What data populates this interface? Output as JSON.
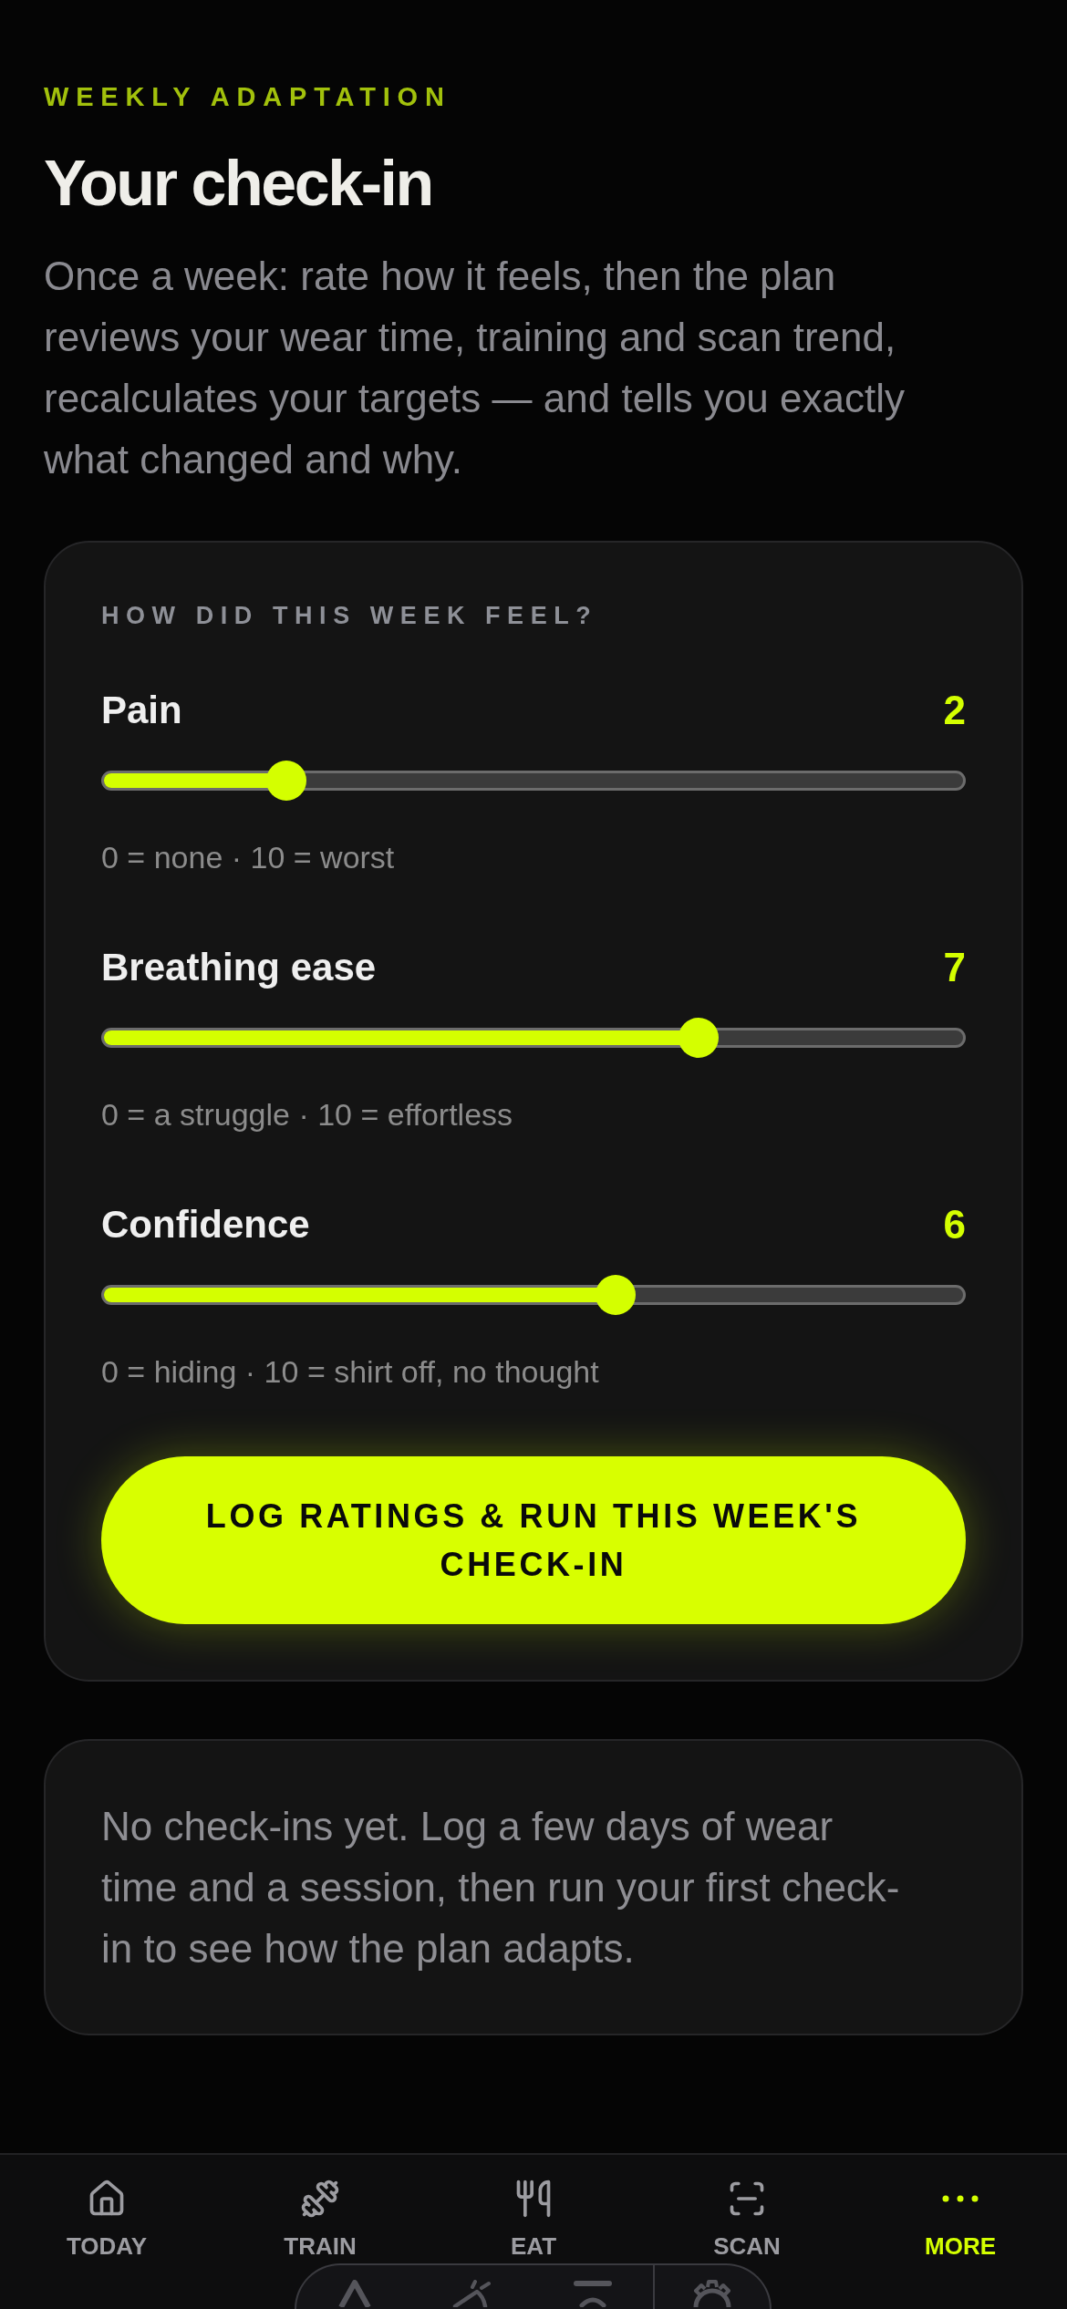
{
  "header": {
    "eyebrow": "WEEKLY ADAPTATION",
    "title": "Your check-in",
    "description": "Once a week: rate how it feels, then the plan reviews your wear time, training and scan trend, recalculates your targets — and tells you exactly what changed and why."
  },
  "ratings_card": {
    "heading": "HOW DID THIS WEEK FEEL?",
    "sliders": [
      {
        "label": "Pain",
        "value": "2",
        "level": 0.2,
        "hint": "0 = none · 10 = worst"
      },
      {
        "label": "Breathing ease",
        "value": "7",
        "level": 0.7,
        "hint": "0 = a struggle · 10 = effortless"
      },
      {
        "label": "Confidence",
        "value": "6",
        "level": 0.6,
        "hint": "0 = hiding · 10 = shirt off, no thought"
      }
    ],
    "button": "LOG RATINGS & RUN THIS WEEK'S CHECK-IN"
  },
  "history": {
    "empty_message": "No check-ins yet. Log a few days of wear time and a session, then run your first check-in to see how the plan adapts."
  },
  "tab_bar": {
    "tabs": [
      {
        "label": "TODAY",
        "selected": false
      },
      {
        "label": "TRAIN",
        "selected": false
      },
      {
        "label": "EAT",
        "selected": false
      },
      {
        "label": "SCAN",
        "selected": false
      },
      {
        "label": "MORE",
        "selected": true
      }
    ]
  }
}
